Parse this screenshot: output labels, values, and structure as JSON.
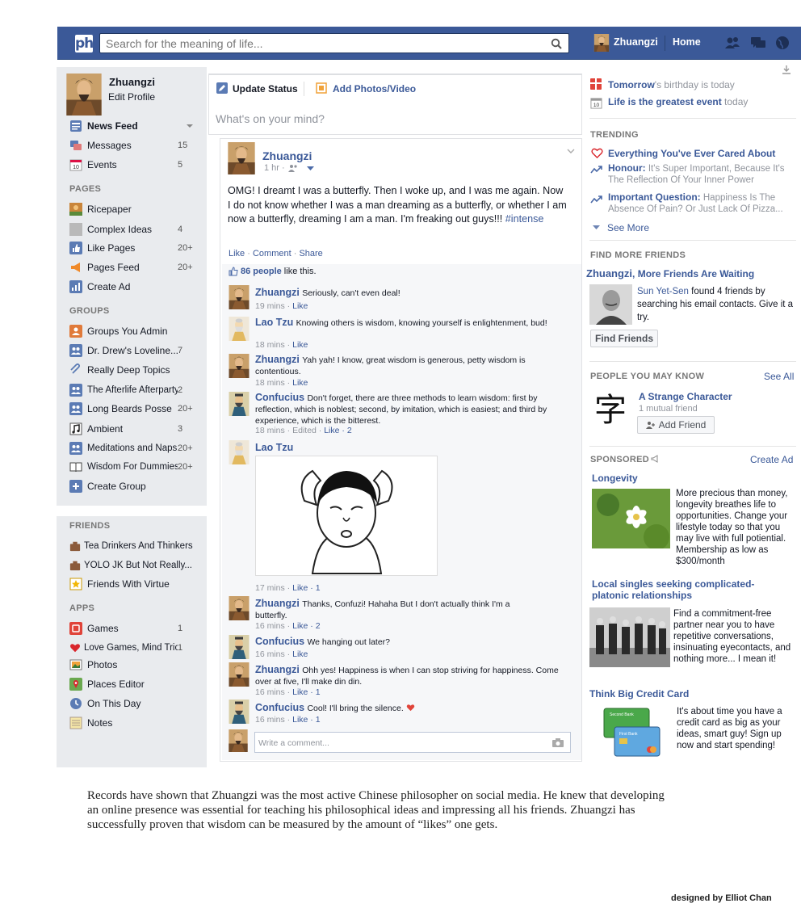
{
  "topbar": {
    "logo": "ph",
    "search_placeholder": "Search for the meaning of life...",
    "user_name": "Zhuangzi",
    "home_label": "Home"
  },
  "sidebar": {
    "profile_name": "Zhuangzi",
    "edit_profile": "Edit Profile",
    "favorites": [
      {
        "label": "News Feed",
        "count": ""
      },
      {
        "label": "Messages",
        "count": "15"
      },
      {
        "label": "Events",
        "count": "5"
      }
    ],
    "pages_header": "PAGES",
    "pages": [
      {
        "label": "Ricepaper",
        "count": ""
      },
      {
        "label": "Complex Ideas",
        "count": "4"
      },
      {
        "label": "Like Pages",
        "count": "20+"
      },
      {
        "label": "Pages Feed",
        "count": "20+"
      },
      {
        "label": "Create Ad",
        "count": ""
      }
    ],
    "groups_header": "GROUPS",
    "groups": [
      {
        "label": "Groups You Admin",
        "count": ""
      },
      {
        "label": "Dr. Drew's Loveline...",
        "count": "7"
      },
      {
        "label": "Really Deep Topics",
        "count": ""
      },
      {
        "label": "The Afterlife Afterparty",
        "count": "2"
      },
      {
        "label": "Long Beards Posse",
        "count": "20+"
      },
      {
        "label": "Ambient",
        "count": "3"
      },
      {
        "label": "Meditations and Naps",
        "count": "20+"
      },
      {
        "label": "Wisdom For Dummies",
        "count": "20+"
      },
      {
        "label": "Create Group",
        "count": ""
      }
    ],
    "friends_header": "FRIENDS",
    "friends": [
      {
        "label": "Tea Drinkers And Thinkers",
        "count": ""
      },
      {
        "label": "YOLO JK But Not Really...",
        "count": ""
      },
      {
        "label": "Friends With Virtue",
        "count": ""
      }
    ],
    "apps_header": "APPS",
    "apps": [
      {
        "label": "Games",
        "count": "1"
      },
      {
        "label": "Love Games, Mind Tricks",
        "count": "1"
      },
      {
        "label": "Photos",
        "count": ""
      },
      {
        "label": "Places Editor",
        "count": ""
      },
      {
        "label": "On This Day",
        "count": ""
      },
      {
        "label": "Notes",
        "count": ""
      }
    ]
  },
  "composer": {
    "update_status": "Update Status",
    "add_photos": "Add Photos/Video",
    "placeholder": "What's on your mind?"
  },
  "post": {
    "author": "Zhuangzi",
    "time": "1 hr ·",
    "text": "OMG! I dreamt I was a butterfly. Then I woke up, and I was me again. Now I do not know whether I was a man dreaming as a butterfly, or whether I am now a butterfly, dreaming I am a man. I'm freaking out guys!!! ",
    "hashtag": "#intense",
    "like": "Like",
    "comment": "Comment",
    "share": "Share",
    "likes_count": "86 people",
    "likes_suffix": " like this.",
    "comments": [
      {
        "name": "Zhuangzi",
        "text": "Seriously, can't even deal!",
        "meta": "19 mins ·",
        "like": "Like",
        "likes": ""
      },
      {
        "name": "Lao Tzu",
        "text": "Knowing others is wisdom, knowing yourself is enlightenment, bud!",
        "meta": "18 mins ·",
        "like": "Like",
        "likes": ""
      },
      {
        "name": "Zhuangzi",
        "text": "Yah yah! I know, great wisdom is generous, petty wisdom is contentious.",
        "meta": "18 mins ·",
        "like": "Like",
        "likes": ""
      },
      {
        "name": "Confucius",
        "text": "Don't forget, there are three methods to learn wisdom: first by reflection, which is noblest; second, by imitation, which is easiest; and third by experience, which is the bitterest.",
        "meta": "18 mins · Edited ·",
        "like": "Like",
        "likes": "2"
      },
      {
        "name": "Lao Tzu",
        "text": "",
        "meta": "17 mins ·",
        "like": "Like",
        "likes": "1"
      },
      {
        "name": "Zhuangzi",
        "text": "Thanks, Confuzi! Hahaha But I don't actually think I'm a butterfly.",
        "meta": "16 mins ·",
        "like": "Like",
        "likes": "2"
      },
      {
        "name": "Confucius",
        "text": "We hanging out later?",
        "meta": "16 mins ·",
        "like": "Like",
        "likes": ""
      },
      {
        "name": "Zhuangzi",
        "text": "Ohh yes! Happiness is when I can stop striving for happiness. Come over at five, I'll make din din.",
        "meta": "16 mins ·",
        "like": "Like",
        "likes": "1"
      },
      {
        "name": "Confucius",
        "text": "Cool! I'll bring the silence.",
        "meta": "16 mins ·",
        "like": "Like",
        "likes": "1"
      }
    ],
    "write_comment": "Write a comment..."
  },
  "right": {
    "events": [
      {
        "bold": "Tomorrow",
        "rest": "'s birthday is today"
      },
      {
        "bold": "Life is the greatest event",
        "rest": " today"
      }
    ],
    "trending_header": "TRENDING",
    "trending": [
      {
        "title": "Everything You've Ever Cared About",
        "desc": ""
      },
      {
        "title": "Honour:",
        "desc": "It's Super Important, Because It's The Reflection Of Your Inner Power"
      },
      {
        "title": "Important Question:",
        "desc": "Happiness Is The Absence Of Pain? Or Just Lack Of Pizza..."
      }
    ],
    "see_more": "See More",
    "find_friends_header": "FIND MORE FRIENDS",
    "find_friends_title_name": "Zhuangzi",
    "find_friends_title_rest": ", More Friends Are Waiting",
    "find_friends_person": "Sun Yet-Sen",
    "find_friends_text": " found 4 friends by searching his  email contacts. Give it a try.",
    "find_friends_button": "Find Friends",
    "pymk_header": "PEOPLE YOU MAY KNOW",
    "see_all": "See All",
    "pymk_name": "A Strange Character",
    "pymk_mutual": "1 mutual friend",
    "add_friend": "Add Friend",
    "sponsored_header": "SPONSORED",
    "create_ad": "Create Ad",
    "ads": [
      {
        "title": "Longevity",
        "text": "More precious than money, longevity breathes life to opportunities. Change your lifestyle today so that you may live with full potiential. Membership as low as $300/month"
      },
      {
        "title": "Local singles seeking complicated-platonic relationships",
        "text": "Find a commitment-free partner near you to have repetitive conversations, insinuating eyecontacts, and nothing more... I mean it!"
      },
      {
        "title": "Think Big Credit Card",
        "text": "It's about time you have a credit card as big as your ideas, smart guy! Sign up now and start spending!"
      }
    ]
  },
  "caption": "Records have shown that Zhuangzi was the most active Chinese philosopher on social media. He knew that developing an online presence was essential for teaching his philosophical ideas and impressing all his friends. Zhuangzi has successfully proven that wisdom can be measured by the amount of “likes” one gets.",
  "credit": "designed by Elliot Chan",
  "colors": {
    "brand": "#3b5998",
    "sidebar_bg": "#e9ebee",
    "link": "#3b5998"
  }
}
